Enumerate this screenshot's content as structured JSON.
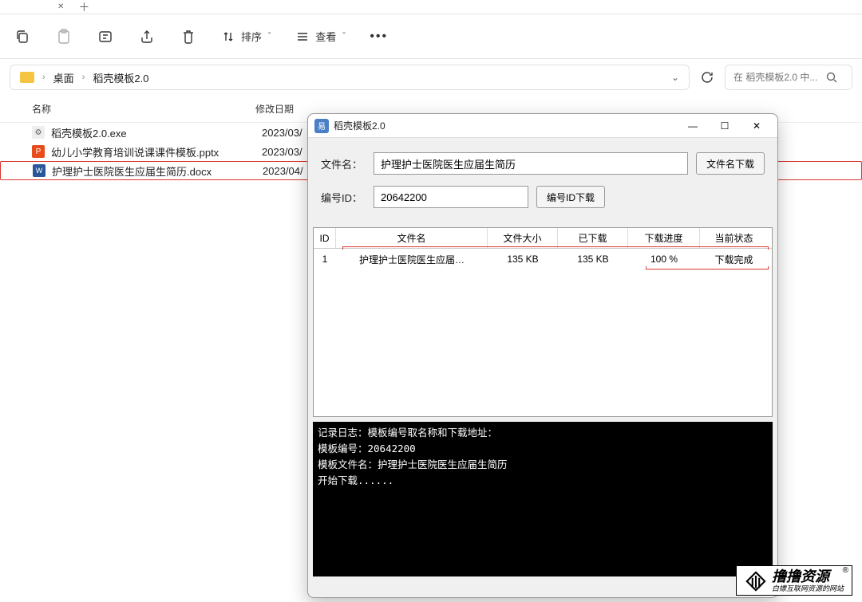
{
  "toolbar": {
    "sort_label": "排序",
    "view_label": "查看"
  },
  "breadcrumb": {
    "items": [
      "桌面",
      "稻壳模板2.0"
    ]
  },
  "search": {
    "placeholder": "在 稻壳模板2.0 中..."
  },
  "file_list": {
    "columns": {
      "name": "名称",
      "date": "修改日期"
    },
    "rows": [
      {
        "icon": "exe",
        "name": "稻壳模板2.0.exe",
        "date": "2023/03/"
      },
      {
        "icon": "pptx",
        "name": "幼儿小学教育培训说课课件模板.pptx",
        "date": "2023/03/"
      },
      {
        "icon": "docx",
        "name": "护理护士医院医生应届生简历.docx",
        "date": "2023/04/"
      }
    ]
  },
  "dl": {
    "title": "稻壳模板2.0",
    "filename_label": "文件名：",
    "filename_value": "护理护士医院医生应届生简历",
    "filename_btn": "文件名下载",
    "id_label": "编号ID：",
    "id_value": "20642200",
    "id_btn": "编号ID下载",
    "grid": {
      "headers": {
        "id": "ID",
        "name": "文件名",
        "size": "文件大小",
        "downloaded": "已下载",
        "progress": "下载进度",
        "status": "当前状态"
      },
      "rows": [
        {
          "id": "1",
          "name": "护理护士医院医生应届…",
          "size": "135 KB",
          "downloaded": "135 KB",
          "progress": "100 %",
          "status": "下载完成"
        }
      ]
    },
    "log": "记录日志：模板编号取名称和下载地址：\n模板编号：20642200\n模板文件名：护理护士医院医生应届生简历\n开始下载......"
  },
  "watermark": {
    "main": "撸撸资源",
    "sub": "白嫖互联网资源的网站"
  }
}
